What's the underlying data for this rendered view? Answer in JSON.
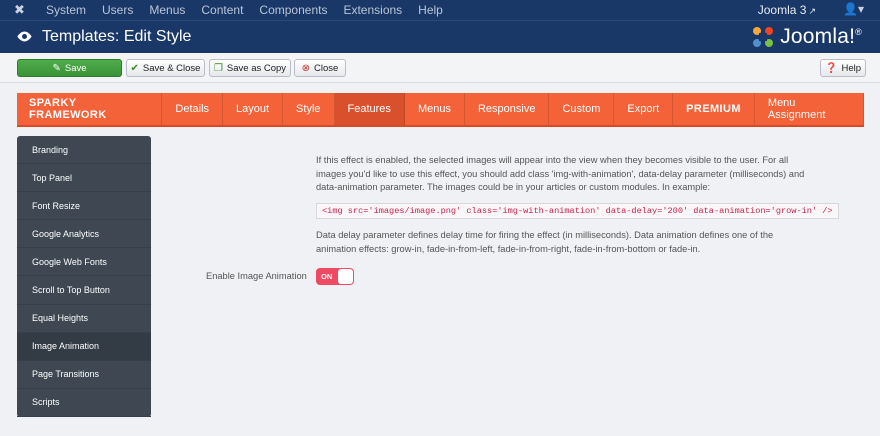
{
  "topbar": {
    "menu": [
      "System",
      "Users",
      "Menus",
      "Content",
      "Components",
      "Extensions",
      "Help"
    ],
    "site_name": "Joomla 3",
    "user_icon": "user-icon"
  },
  "titlebar": {
    "title": "Templates: Edit Style",
    "logo_text": "Joomla!",
    "logo_mark": "®"
  },
  "toolbar": {
    "save": "Save",
    "save_close": "Save & Close",
    "save_copy": "Save as Copy",
    "close": "Close",
    "help": "Help"
  },
  "tabs": [
    {
      "label": "SPARKY FRAMEWORK",
      "type": "brand"
    },
    {
      "label": "Details"
    },
    {
      "label": "Layout"
    },
    {
      "label": "Style"
    },
    {
      "label": "Features",
      "active": true
    },
    {
      "label": "Menus"
    },
    {
      "label": "Responsive"
    },
    {
      "label": "Custom"
    },
    {
      "label": "Export"
    },
    {
      "label": "PREMIUM",
      "type": "bold"
    },
    {
      "label": "Menu Assignment"
    }
  ],
  "sidebar": {
    "items": [
      "Branding",
      "Top Panel",
      "Font Resize",
      "Google Analytics",
      "Google Web Fonts",
      "Scroll to Top Button",
      "Equal Heights",
      "Image Animation",
      "Page Transitions",
      "Scripts"
    ],
    "active_index": 7
  },
  "content": {
    "description": "If this effect is enabled, the selected images will appear into the view when they becomes visible to the user. For all images you'd like to use this effect, you should add class 'img-with-animation', data-delay parameter (milliseconds) and data-animation parameter. The images could be in your articles or custom modules. In example:",
    "code": "<img src='images/image.png' class='img-with-animation' data-delay='200' data-animation='grow-in' />",
    "description2": "Data delay parameter defines delay time for firing the effect (in milliseconds). Data animation defines one of the animation effects: grow-in, fade-in-from-left, fade-in-from-right, fade-in-from-bottom or fade-in.",
    "field_label": "Enable Image Animation",
    "toggle_label": "ON"
  },
  "colors": {
    "header_bg": "#1a3867",
    "tab_bg": "#f4623a",
    "sidebar_bg": "#3e4752",
    "save_green": "#4fad4b",
    "toggle_on": "#ee4a64"
  }
}
